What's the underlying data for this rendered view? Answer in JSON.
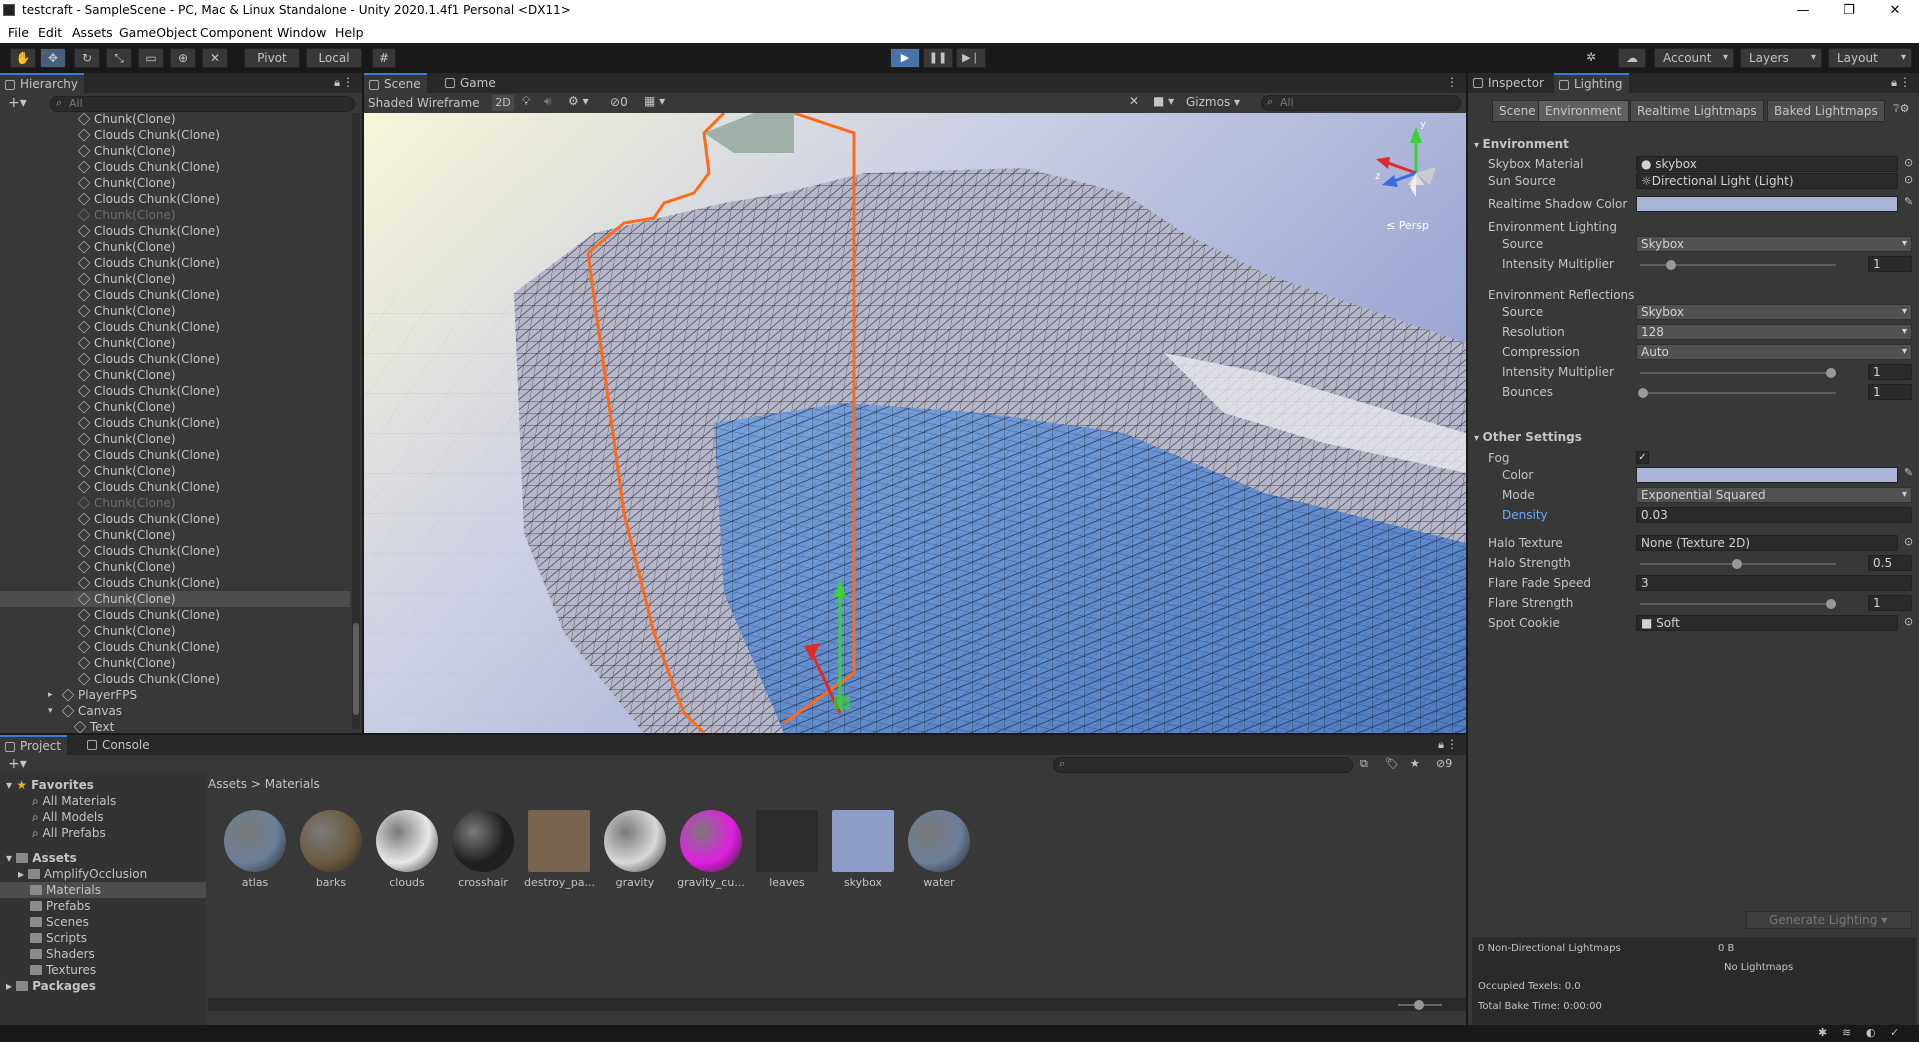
{
  "window": {
    "title": "testcraft - SampleScene - PC, Mac & Linux Standalone - Unity 2020.1.4f1 Personal <DX11>",
    "minimize": "—",
    "maximize": "❐",
    "close": "✕"
  },
  "menu": [
    "File",
    "Edit",
    "Assets",
    "GameObject",
    "Component",
    "Window",
    "Help"
  ],
  "toolbar": {
    "pivot": "Pivot",
    "local": "Local",
    "account": "Account",
    "layers": "Layers",
    "layout": "Layout"
  },
  "hierarchy": {
    "tab": "Hierarchy",
    "search_placeholder": "All",
    "rows": [
      {
        "label": "Chunk(Clone)",
        "dim": false
      },
      {
        "label": "Clouds Chunk(Clone)",
        "dim": false
      },
      {
        "label": "Chunk(Clone)",
        "dim": false
      },
      {
        "label": "Clouds Chunk(Clone)",
        "dim": false
      },
      {
        "label": "Chunk(Clone)",
        "dim": false
      },
      {
        "label": "Clouds Chunk(Clone)",
        "dim": false
      },
      {
        "label": "Chunk(Clone)",
        "dim": true
      },
      {
        "label": "Clouds Chunk(Clone)",
        "dim": false
      },
      {
        "label": "Chunk(Clone)",
        "dim": false
      },
      {
        "label": "Clouds Chunk(Clone)",
        "dim": false
      },
      {
        "label": "Chunk(Clone)",
        "dim": false
      },
      {
        "label": "Clouds Chunk(Clone)",
        "dim": false
      },
      {
        "label": "Chunk(Clone)",
        "dim": false
      },
      {
        "label": "Clouds Chunk(Clone)",
        "dim": false
      },
      {
        "label": "Chunk(Clone)",
        "dim": false
      },
      {
        "label": "Clouds Chunk(Clone)",
        "dim": false
      },
      {
        "label": "Chunk(Clone)",
        "dim": false
      },
      {
        "label": "Clouds Chunk(Clone)",
        "dim": false
      },
      {
        "label": "Chunk(Clone)",
        "dim": false
      },
      {
        "label": "Clouds Chunk(Clone)",
        "dim": false
      },
      {
        "label": "Chunk(Clone)",
        "dim": false
      },
      {
        "label": "Clouds Chunk(Clone)",
        "dim": false
      },
      {
        "label": "Chunk(Clone)",
        "dim": false
      },
      {
        "label": "Clouds Chunk(Clone)",
        "dim": false
      },
      {
        "label": "Chunk(Clone)",
        "dim": true
      },
      {
        "label": "Clouds Chunk(Clone)",
        "dim": false
      },
      {
        "label": "Chunk(Clone)",
        "dim": false
      },
      {
        "label": "Clouds Chunk(Clone)",
        "dim": false
      },
      {
        "label": "Chunk(Clone)",
        "dim": false
      },
      {
        "label": "Clouds Chunk(Clone)",
        "dim": false
      },
      {
        "label": "Chunk(Clone)",
        "dim": false,
        "selected": true
      },
      {
        "label": "Clouds Chunk(Clone)",
        "dim": false
      },
      {
        "label": "Chunk(Clone)",
        "dim": false
      },
      {
        "label": "Clouds Chunk(Clone)",
        "dim": false
      },
      {
        "label": "Chunk(Clone)",
        "dim": false
      },
      {
        "label": "Clouds Chunk(Clone)",
        "dim": false
      }
    ],
    "player": "PlayerFPS",
    "canvas": "Canvas",
    "text": "Text"
  },
  "scene": {
    "tab_scene": "Scene",
    "tab_game": "Game",
    "draw_mode": "Shaded Wireframe",
    "mode_2d": "2D",
    "hidden_count": "0",
    "gizmos": "Gizmos",
    "search_placeholder": "All",
    "persp": "≤ Persp",
    "axis_y": "y",
    "axis_z": "z"
  },
  "inspector": {
    "tab_inspector": "Inspector",
    "tab_lighting": "Lighting",
    "subtabs": [
      "Scene",
      "Environment",
      "Realtime Lightmaps",
      "Baked Lightmaps"
    ],
    "env_header": "Environment",
    "skybox_label": "Skybox Material",
    "skybox_value": "skybox",
    "sun_label": "Sun Source",
    "sun_value": "Directional Light (Light)",
    "shadow_color_label": "Realtime Shadow Color",
    "env_lighting": "Environment Lighting",
    "source_label": "Source",
    "source_value": "Skybox",
    "intensity_label": "Intensity Multiplier",
    "intensity_value": "1",
    "env_reflections": "Environment Reflections",
    "ref_source_label": "Source",
    "ref_source_value": "Skybox",
    "resolution_label": "Resolution",
    "resolution_value": "128",
    "compression_label": "Compression",
    "compression_value": "Auto",
    "ref_intensity_label": "Intensity Multiplier",
    "ref_intensity_value": "1",
    "bounces_label": "Bounces",
    "bounces_value": "1",
    "other_header": "Other Settings",
    "fog_label": "Fog",
    "fog_color_label": "Color",
    "fog_mode_label": "Mode",
    "fog_mode_value": "Exponential Squared",
    "density_label": "Density",
    "density_value": "0.03",
    "halo_tex_label": "Halo Texture",
    "halo_tex_value": "None (Texture 2D)",
    "halo_strength_label": "Halo Strength",
    "halo_strength_value": "0.5",
    "flare_fade_label": "Flare Fade Speed",
    "flare_fade_value": "3",
    "flare_strength_label": "Flare Strength",
    "flare_strength_value": "1",
    "spot_cookie_label": "Spot Cookie",
    "spot_cookie_value": "Soft",
    "generate": "Generate Lighting",
    "non_dir": "0 Non-Directional Lightmaps",
    "size": "0 B",
    "no_lightmaps": "No Lightmaps",
    "occupied": "Occupied Texels: 0.0",
    "bake_time": "Total Bake Time: 0:00:00"
  },
  "project": {
    "tab_project": "Project",
    "tab_console": "Console",
    "hidden_count": "9",
    "favorites": "Favorites",
    "fav_items": [
      "All Materials",
      "All Models",
      "All Prefabs"
    ],
    "assets": "Assets",
    "folders": [
      "AmplifyOcclusion",
      "Materials",
      "Prefabs",
      "Scenes",
      "Scripts",
      "Shaders",
      "Textures"
    ],
    "packages": "Packages",
    "breadcrumb_root": "Assets",
    "breadcrumb_sep": ">",
    "breadcrumb_current": "Materials",
    "materials": [
      {
        "name": "atlas",
        "color": "#6b7f99"
      },
      {
        "name": "barks",
        "color": "#6b5a3e"
      },
      {
        "name": "clouds",
        "color": "#e8e8e8"
      },
      {
        "name": "crosshair",
        "color": "#1f1f1f"
      },
      {
        "name": "destroy_pa...",
        "color": "#7a6650"
      },
      {
        "name": "gravity",
        "color": "#d8d8d8"
      },
      {
        "name": "gravity_cu...",
        "color": "#e11ee0"
      },
      {
        "name": "leaves",
        "color": "#2c2c2c"
      },
      {
        "name": "skybox",
        "color": "#8e9cc8"
      },
      {
        "name": "water",
        "color": "#6b7f99"
      }
    ]
  }
}
